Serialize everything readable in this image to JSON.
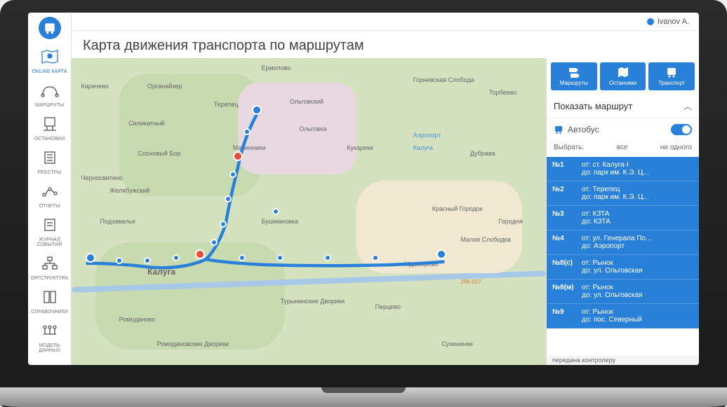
{
  "user": {
    "name": "Ivanov A."
  },
  "title": "Карта движения транспорта по маршрутам",
  "sidebar": {
    "items": [
      {
        "label": "ONLINE КАРТА",
        "icon": "map-pin"
      },
      {
        "label": "МАРШРУТЫ",
        "icon": "routes"
      },
      {
        "label": "ОСТАНОВКИ",
        "icon": "stops"
      },
      {
        "label": "РЕЕСТРЫ",
        "icon": "registry"
      },
      {
        "label": "ОТЧЕТЫ",
        "icon": "reports"
      },
      {
        "label": "ЖУРНАЛ СОБЫТИЙ",
        "icon": "journal"
      },
      {
        "label": "ОРГСТРУКТУРА",
        "icon": "org"
      },
      {
        "label": "СПРАВОЧНИКИ",
        "icon": "reference"
      },
      {
        "label": "МОДЕЛЬ ДАННЫХ",
        "icon": "model"
      }
    ]
  },
  "map": {
    "places": [
      "Карачево",
      "Ермолово",
      "Горневская Слобода",
      "Торбеево",
      "Органайзер",
      "Терепец",
      "Ольговский",
      "Силикатный",
      "Ольговка",
      "Кукареки",
      "Аэропорт",
      "Калуга",
      "Сосновый Бор",
      "Малинники",
      "Дубрава",
      "Черносвитино",
      "Желябужский",
      "Подзавалье",
      "Бушмановка",
      "Красный Городок",
      "Городня",
      "Калуга",
      "Ждамирово",
      "Малая Слободка",
      "Турынинские Дворики",
      "Ромоданово",
      "Ромодановские Дворики",
      "Перцево",
      "Сухининки"
    ],
    "route_road": "29К-027"
  },
  "panel": {
    "tabs": [
      {
        "label": "Маршруты"
      },
      {
        "label": "Остановки"
      },
      {
        "label": "Транспорт"
      }
    ],
    "show_route": "Показать маршрут",
    "filter": {
      "label": "Автобус"
    },
    "select": {
      "label": "Выбрать:",
      "all": "все",
      "none": "ни одного"
    },
    "status": "передана контролеру",
    "routes": [
      {
        "num": "№1",
        "from": "от: ст. Калуга-I",
        "to": "до: парк им. К.Э. Ц..."
      },
      {
        "num": "№2",
        "from": "от: Терепец",
        "to": "до: парк им. К.Э. Ц..."
      },
      {
        "num": "№3",
        "from": "от: КЗТА",
        "to": "до: КЗТА"
      },
      {
        "num": "№4",
        "from": "от: ул. Генерала По...",
        "to": "до: Аэропорт"
      },
      {
        "num": "№8(с)",
        "from": "от: Рынок",
        "to": "до: ул. Ольговская"
      },
      {
        "num": "№8(м)",
        "from": "от: Рынок",
        "to": "до: ул. Ольговская"
      },
      {
        "num": "№9",
        "from": "от: Рынок",
        "to": "до: пос. Северный"
      }
    ]
  }
}
